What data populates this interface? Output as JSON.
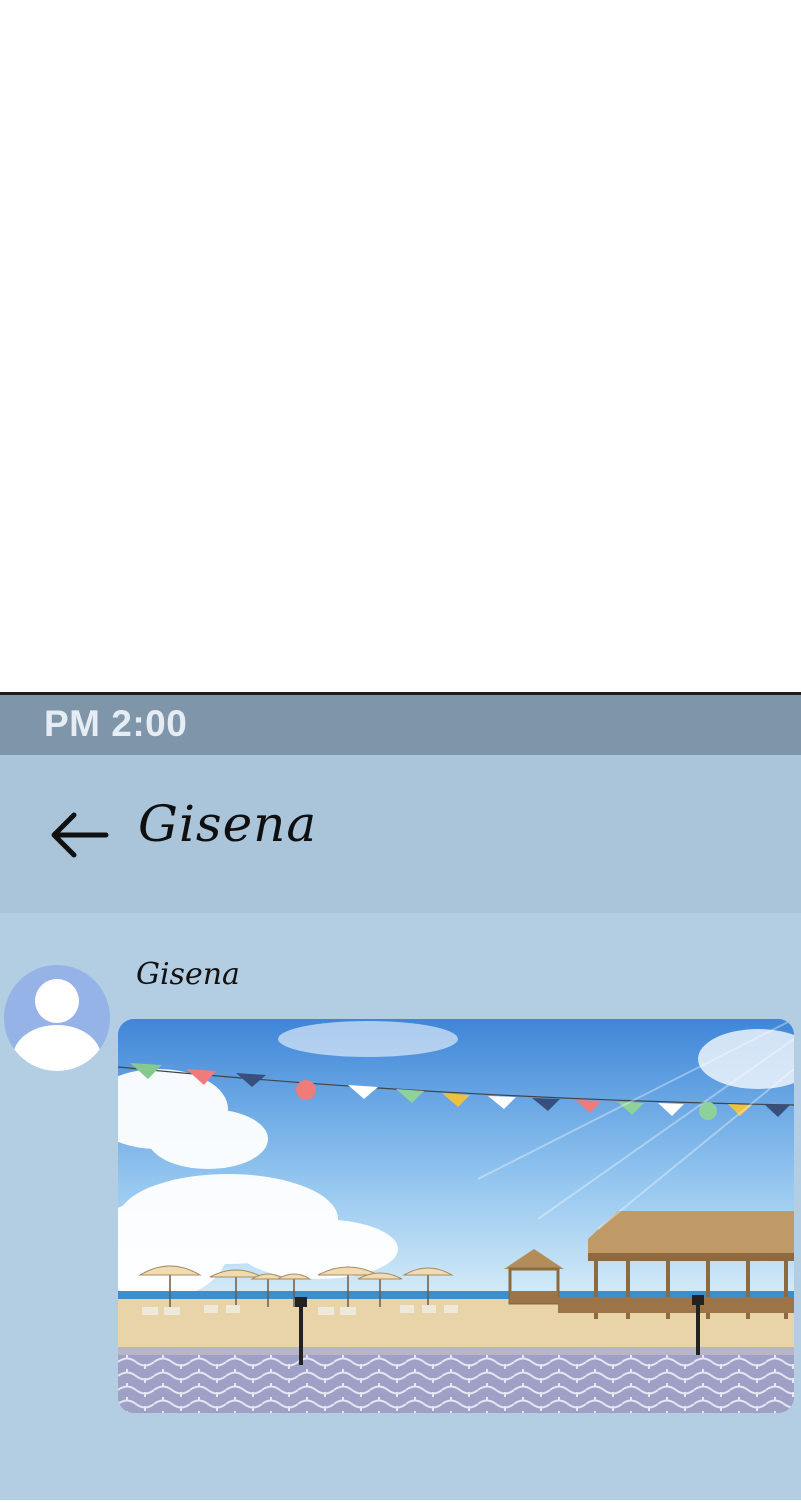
{
  "status_bar": {
    "time": "PM 2:00"
  },
  "header": {
    "back_icon": "arrow-left-icon",
    "title": "Gisena"
  },
  "message": {
    "sender_name": "Gisena",
    "avatar_icon": "default-user-avatar",
    "attachment": {
      "type": "image"
    }
  },
  "colors": {
    "status_bar_bg": "#7f95aa",
    "header_bg": "#aac4da",
    "chat_bg": "#b3cde3",
    "avatar_bg": "#95b3e7"
  }
}
